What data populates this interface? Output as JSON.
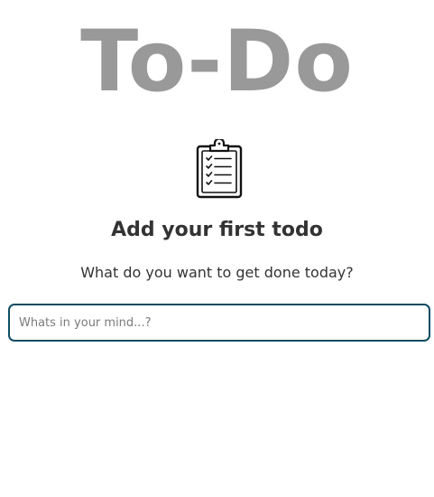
{
  "app": {
    "title": "To-Do"
  },
  "empty_state": {
    "icon": "clipboard-checklist-icon",
    "heading": "Add your first todo",
    "subtext": "What do you want to get done today?"
  },
  "new_todo": {
    "value": "",
    "placeholder": "Whats in your mind...?"
  },
  "colors": {
    "title": "#999999",
    "text": "#333333",
    "input_border": "#0f4c63",
    "background": "#ffffff"
  }
}
